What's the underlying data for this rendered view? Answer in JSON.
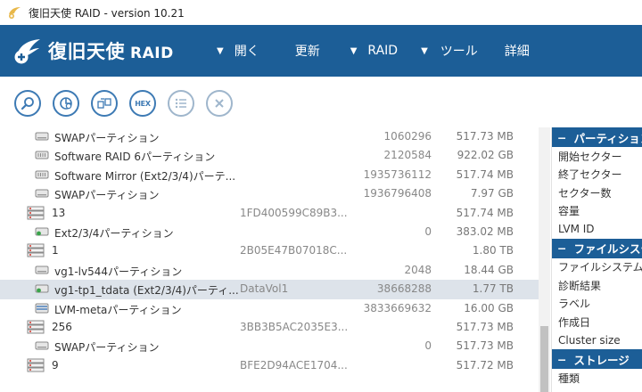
{
  "window": {
    "title": "復旧天使 RAID - version 10.21"
  },
  "header": {
    "logo_text": "復旧天使",
    "logo_sub": "RAID",
    "menu": [
      {
        "label": "開く"
      },
      {
        "label": "更新"
      },
      {
        "label": "RAID"
      },
      {
        "label": "ツール"
      },
      {
        "label": "詳細"
      }
    ]
  },
  "toolbar": {
    "buttons": [
      {
        "icon": "search-icon"
      },
      {
        "icon": "chart-icon"
      },
      {
        "icon": "raid-build-icon"
      },
      {
        "label": "HEX",
        "icon": "hex-icon"
      },
      {
        "icon": "list-icon"
      },
      {
        "icon": "close-icon"
      }
    ]
  },
  "rows": [
    {
      "type": "partition",
      "name": "SWAPパーティション",
      "sig": "",
      "sector": "1060296",
      "size": "517.73 MB"
    },
    {
      "type": "raid-partition",
      "name": "Software RAID 6パーティション",
      "sig": "",
      "sector": "2120584",
      "size": "922.02 GB"
    },
    {
      "type": "raid-partition",
      "name": "Software Mirror (Ext2/3/4)パーテ...",
      "sig": "",
      "sector": "1935736112",
      "size": "517.74 MB"
    },
    {
      "type": "partition",
      "name": "SWAPパーティション",
      "sig": "",
      "sector": "1936796408",
      "size": "7.97 GB"
    },
    {
      "type": "disk",
      "name": "13",
      "sig": "1FD400599C89B3...",
      "sector": "",
      "size": "517.74 MB"
    },
    {
      "type": "partition-ok",
      "name": "Ext2/3/4パーティション",
      "sig": "",
      "sector": "0",
      "size": "383.02 MB"
    },
    {
      "type": "disk",
      "name": "1",
      "sig": "2B05E47B07018C...",
      "sector": "",
      "size": "1.80 TB"
    },
    {
      "type": "partition",
      "name": "vg1-lv544パーティション",
      "sig": "",
      "sector": "2048",
      "size": "18.44 GB"
    },
    {
      "type": "partition-ok",
      "name": "vg1-tp1_tdata (Ext2/3/4)パーティ...",
      "sig": "DataVol1",
      "sector": "38668288",
      "size": "1.77 TB",
      "selected": true
    },
    {
      "type": "lvm",
      "name": "LVM-metaパーティション",
      "sig": "",
      "sector": "3833669632",
      "size": "16.00 GB"
    },
    {
      "type": "disk",
      "name": "256",
      "sig": "3BB3B5AC2035E3...",
      "sector": "",
      "size": "517.73 MB"
    },
    {
      "type": "partition",
      "name": "SWAPパーティション",
      "sig": "",
      "sector": "0",
      "size": "517.73 MB"
    },
    {
      "type": "disk",
      "name": "9",
      "sig": "BFE2D94ACE1704...",
      "sector": "",
      "size": "517.72 MB"
    }
  ],
  "properties": {
    "sections": [
      {
        "title": "パーティション",
        "items": [
          "開始セクター",
          "終了セクター",
          "セクター数",
          "容量",
          "LVM ID"
        ]
      },
      {
        "title": "ファイルシステム",
        "items": [
          "ファイルシステム",
          "診断結果",
          "ラベル",
          "作成日",
          "Cluster size"
        ]
      },
      {
        "title": "ストレージ",
        "items": [
          "種類"
        ]
      }
    ]
  },
  "colors": {
    "brand": "#1c5e97",
    "accent": "#3d7ab4",
    "selected_row": "#dde3ea"
  }
}
